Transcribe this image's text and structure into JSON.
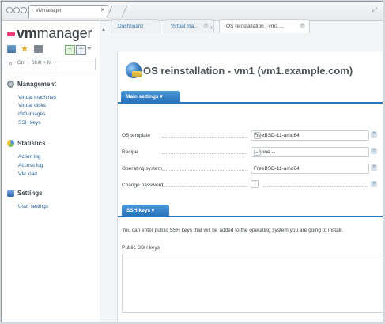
{
  "browser": {
    "tab_title": "VMmanager",
    "tab_close": "×"
  },
  "app": {
    "logo_brand": "vm",
    "logo_name": "manager"
  },
  "sidebar": {
    "search_placeholder": "Ctrl + Shift + M",
    "sections": [
      {
        "title": "Management",
        "items": [
          "Virtual machines",
          "Virtual disks",
          "ISO-images",
          "SSH keys"
        ]
      },
      {
        "title": "Statistics",
        "items": [
          "Action log",
          "Access log",
          "VM load"
        ]
      },
      {
        "title": "Settings",
        "items": [
          "User settings"
        ]
      }
    ]
  },
  "tabs": {
    "items": [
      "Dashboard",
      "Virtual ma...",
      "OS reinstallation - vm1 ..."
    ],
    "close": "×"
  },
  "page": {
    "title": "OS reinstallation - vm1 (vm1.example.com)"
  },
  "main_settings": {
    "label": "Main settings ▾",
    "fields": [
      {
        "label": "OS template",
        "value": "FreeBSD-11-amd64",
        "type": "select"
      },
      {
        "label": "Recipe",
        "value": "-- none --",
        "type": "select"
      },
      {
        "label": "Operating system",
        "value": "FreeBSD-11-amd64",
        "type": "input"
      },
      {
        "label": "Change password",
        "value": "",
        "type": "checkbox"
      }
    ],
    "help": "?"
  },
  "ssh_keys": {
    "label": "SSH-keys ▾",
    "description": "You can enter public SSH keys that will be added to the operating system you are going to install.",
    "public_keys_label": "Public SSH keys"
  }
}
